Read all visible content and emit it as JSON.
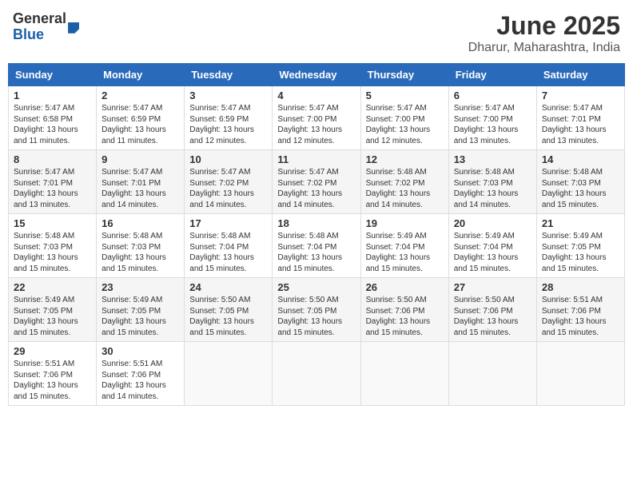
{
  "header": {
    "logo_general": "General",
    "logo_blue": "Blue",
    "month_title": "June 2025",
    "location": "Dharur, Maharashtra, India"
  },
  "weekdays": [
    "Sunday",
    "Monday",
    "Tuesday",
    "Wednesday",
    "Thursday",
    "Friday",
    "Saturday"
  ],
  "weeks": [
    [
      {
        "day": 1,
        "sunrise": "5:47 AM",
        "sunset": "6:58 PM",
        "daylight": "13 hours and 11 minutes."
      },
      {
        "day": 2,
        "sunrise": "5:47 AM",
        "sunset": "6:59 PM",
        "daylight": "13 hours and 11 minutes."
      },
      {
        "day": 3,
        "sunrise": "5:47 AM",
        "sunset": "6:59 PM",
        "daylight": "13 hours and 12 minutes."
      },
      {
        "day": 4,
        "sunrise": "5:47 AM",
        "sunset": "7:00 PM",
        "daylight": "13 hours and 12 minutes."
      },
      {
        "day": 5,
        "sunrise": "5:47 AM",
        "sunset": "7:00 PM",
        "daylight": "13 hours and 12 minutes."
      },
      {
        "day": 6,
        "sunrise": "5:47 AM",
        "sunset": "7:00 PM",
        "daylight": "13 hours and 13 minutes."
      },
      {
        "day": 7,
        "sunrise": "5:47 AM",
        "sunset": "7:01 PM",
        "daylight": "13 hours and 13 minutes."
      }
    ],
    [
      {
        "day": 8,
        "sunrise": "5:47 AM",
        "sunset": "7:01 PM",
        "daylight": "13 hours and 13 minutes."
      },
      {
        "day": 9,
        "sunrise": "5:47 AM",
        "sunset": "7:01 PM",
        "daylight": "13 hours and 14 minutes."
      },
      {
        "day": 10,
        "sunrise": "5:47 AM",
        "sunset": "7:02 PM",
        "daylight": "13 hours and 14 minutes."
      },
      {
        "day": 11,
        "sunrise": "5:47 AM",
        "sunset": "7:02 PM",
        "daylight": "13 hours and 14 minutes."
      },
      {
        "day": 12,
        "sunrise": "5:48 AM",
        "sunset": "7:02 PM",
        "daylight": "13 hours and 14 minutes."
      },
      {
        "day": 13,
        "sunrise": "5:48 AM",
        "sunset": "7:03 PM",
        "daylight": "13 hours and 14 minutes."
      },
      {
        "day": 14,
        "sunrise": "5:48 AM",
        "sunset": "7:03 PM",
        "daylight": "13 hours and 15 minutes."
      }
    ],
    [
      {
        "day": 15,
        "sunrise": "5:48 AM",
        "sunset": "7:03 PM",
        "daylight": "13 hours and 15 minutes."
      },
      {
        "day": 16,
        "sunrise": "5:48 AM",
        "sunset": "7:03 PM",
        "daylight": "13 hours and 15 minutes."
      },
      {
        "day": 17,
        "sunrise": "5:48 AM",
        "sunset": "7:04 PM",
        "daylight": "13 hours and 15 minutes."
      },
      {
        "day": 18,
        "sunrise": "5:48 AM",
        "sunset": "7:04 PM",
        "daylight": "13 hours and 15 minutes."
      },
      {
        "day": 19,
        "sunrise": "5:49 AM",
        "sunset": "7:04 PM",
        "daylight": "13 hours and 15 minutes."
      },
      {
        "day": 20,
        "sunrise": "5:49 AM",
        "sunset": "7:04 PM",
        "daylight": "13 hours and 15 minutes."
      },
      {
        "day": 21,
        "sunrise": "5:49 AM",
        "sunset": "7:05 PM",
        "daylight": "13 hours and 15 minutes."
      }
    ],
    [
      {
        "day": 22,
        "sunrise": "5:49 AM",
        "sunset": "7:05 PM",
        "daylight": "13 hours and 15 minutes."
      },
      {
        "day": 23,
        "sunrise": "5:49 AM",
        "sunset": "7:05 PM",
        "daylight": "13 hours and 15 minutes."
      },
      {
        "day": 24,
        "sunrise": "5:50 AM",
        "sunset": "7:05 PM",
        "daylight": "13 hours and 15 minutes."
      },
      {
        "day": 25,
        "sunrise": "5:50 AM",
        "sunset": "7:05 PM",
        "daylight": "13 hours and 15 minutes."
      },
      {
        "day": 26,
        "sunrise": "5:50 AM",
        "sunset": "7:06 PM",
        "daylight": "13 hours and 15 minutes."
      },
      {
        "day": 27,
        "sunrise": "5:50 AM",
        "sunset": "7:06 PM",
        "daylight": "13 hours and 15 minutes."
      },
      {
        "day": 28,
        "sunrise": "5:51 AM",
        "sunset": "7:06 PM",
        "daylight": "13 hours and 15 minutes."
      }
    ],
    [
      {
        "day": 29,
        "sunrise": "5:51 AM",
        "sunset": "7:06 PM",
        "daylight": "13 hours and 15 minutes."
      },
      {
        "day": 30,
        "sunrise": "5:51 AM",
        "sunset": "7:06 PM",
        "daylight": "13 hours and 14 minutes."
      },
      null,
      null,
      null,
      null,
      null
    ]
  ],
  "labels": {
    "sunrise_prefix": "Sunrise: ",
    "sunset_prefix": "Sunset: ",
    "daylight_label": "Daylight: "
  }
}
